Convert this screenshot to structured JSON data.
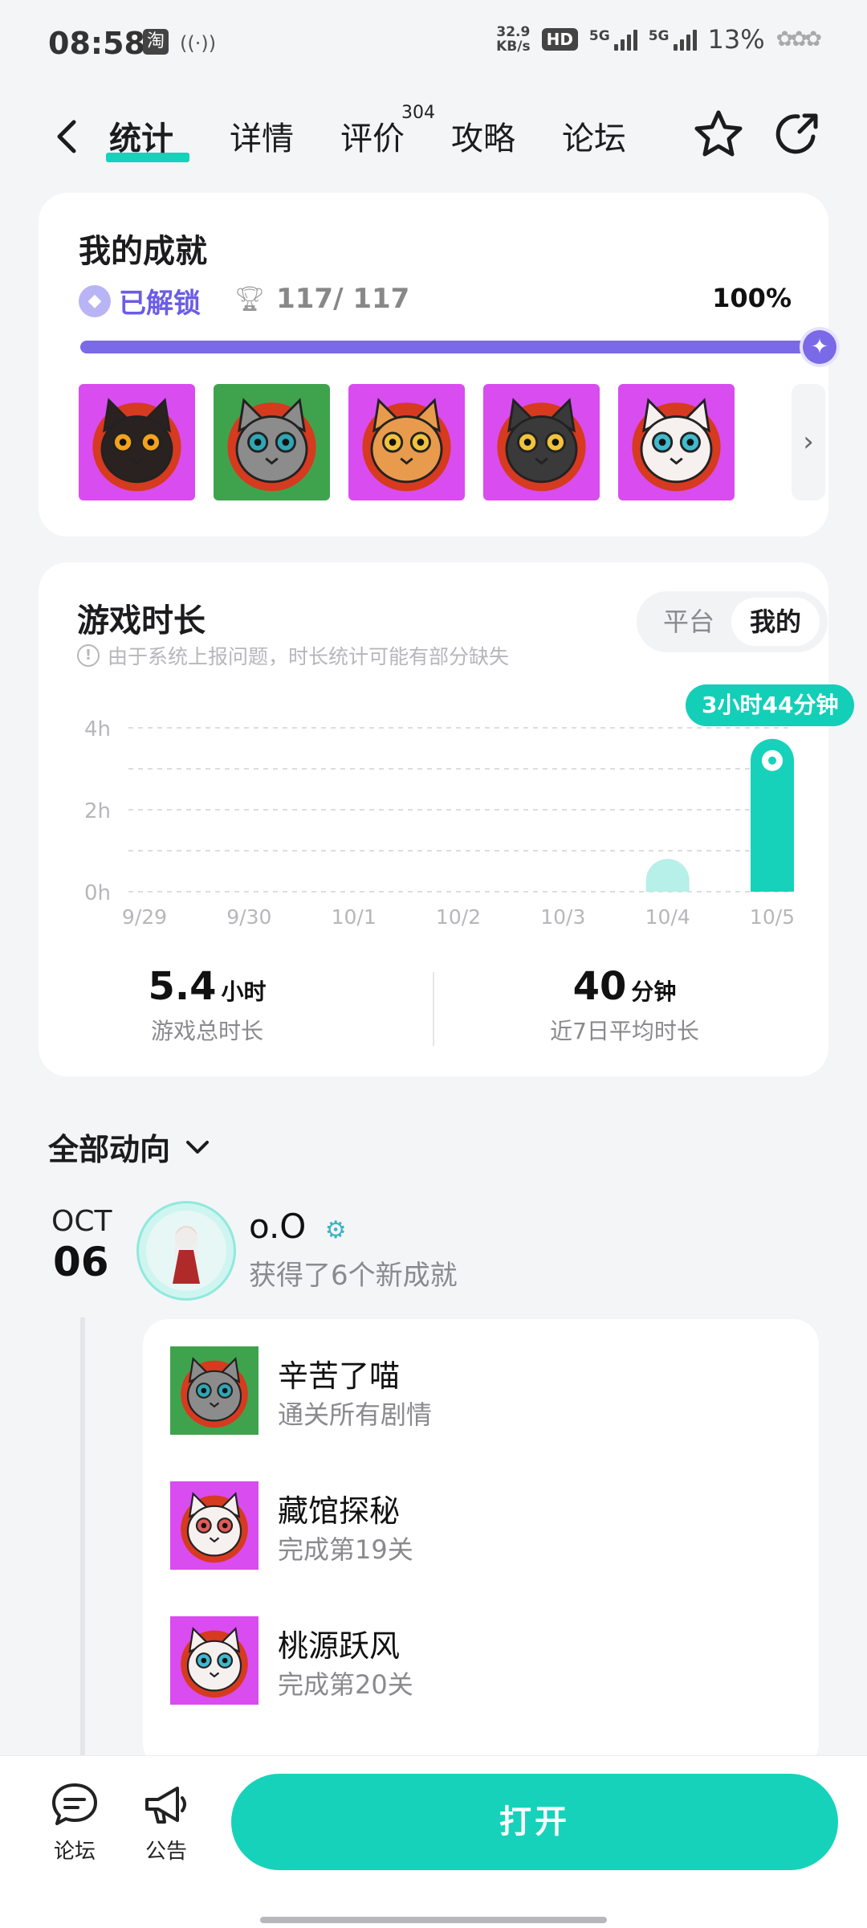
{
  "status_bar": {
    "time": "08:58",
    "app_icon": "淘",
    "net_speed_value": "32.9",
    "net_speed_unit": "KB/s",
    "hd": "HD",
    "sim1": "5G",
    "sim2": "5G",
    "battery": "13%"
  },
  "nav": {
    "tabs": [
      "统计",
      "详情",
      "评价",
      "攻略",
      "论坛"
    ],
    "active_tab": 0,
    "review_count": "304"
  },
  "achievements": {
    "title": "我的成就",
    "unlocked_label": "已解锁",
    "count": "117/ 117",
    "percent": "100%",
    "progress_value": 1.0,
    "icons": [
      "cat-black-icon",
      "cat-grey-icon",
      "cat-orange-icon",
      "cat-tabby-icon",
      "cat-white-icon"
    ],
    "icon_bg_colors": [
      "#d94cf0",
      "#3fa34d",
      "#d94cf0",
      "#d94cf0",
      "#d94cf0"
    ]
  },
  "playtime": {
    "title": "游戏时长",
    "note": "由于系统上报问题，时长统计可能有部分缺失",
    "toggle": [
      "平台",
      "我的"
    ],
    "toggle_selected": 1,
    "tooltip": "3小时44分钟",
    "total_value": "5.4",
    "total_unit": "小时",
    "total_label": "游戏总时长",
    "avg_value": "40",
    "avg_unit": "分钟",
    "avg_label": "近7日平均时长"
  },
  "chart_data": {
    "type": "bar",
    "categories": [
      "9/29",
      "9/30",
      "10/1",
      "10/2",
      "10/3",
      "10/4",
      "10/5"
    ],
    "values": [
      0,
      0,
      0,
      0,
      0,
      0.8,
      3.73
    ],
    "ytick_labels": [
      "0h",
      "2h",
      "4h"
    ],
    "ylim": [
      0,
      4
    ],
    "grid": true,
    "colors": {
      "highlight": "#16d2bb",
      "normal": "#b6f0e8"
    }
  },
  "feed": {
    "title": "全部动向",
    "month": "OCT",
    "day": "06",
    "user": "o.O",
    "action": "获得了6个新成就",
    "items": [
      {
        "title": "辛苦了喵",
        "desc": "通关所有剧情",
        "icon": "cat-grey-icon",
        "bg": "#3fa34d"
      },
      {
        "title": "藏馆探秘",
        "desc": "完成第19关",
        "icon": "cat-white-fluffy-icon",
        "bg": "#d94cf0"
      },
      {
        "title": "桃源跃风",
        "desc": "完成第20关",
        "icon": "cat-white-icon",
        "bg": "#d94cf0"
      }
    ]
  },
  "bottom": {
    "forum_label": "论坛",
    "notice_label": "公告",
    "open_label": "打开"
  }
}
